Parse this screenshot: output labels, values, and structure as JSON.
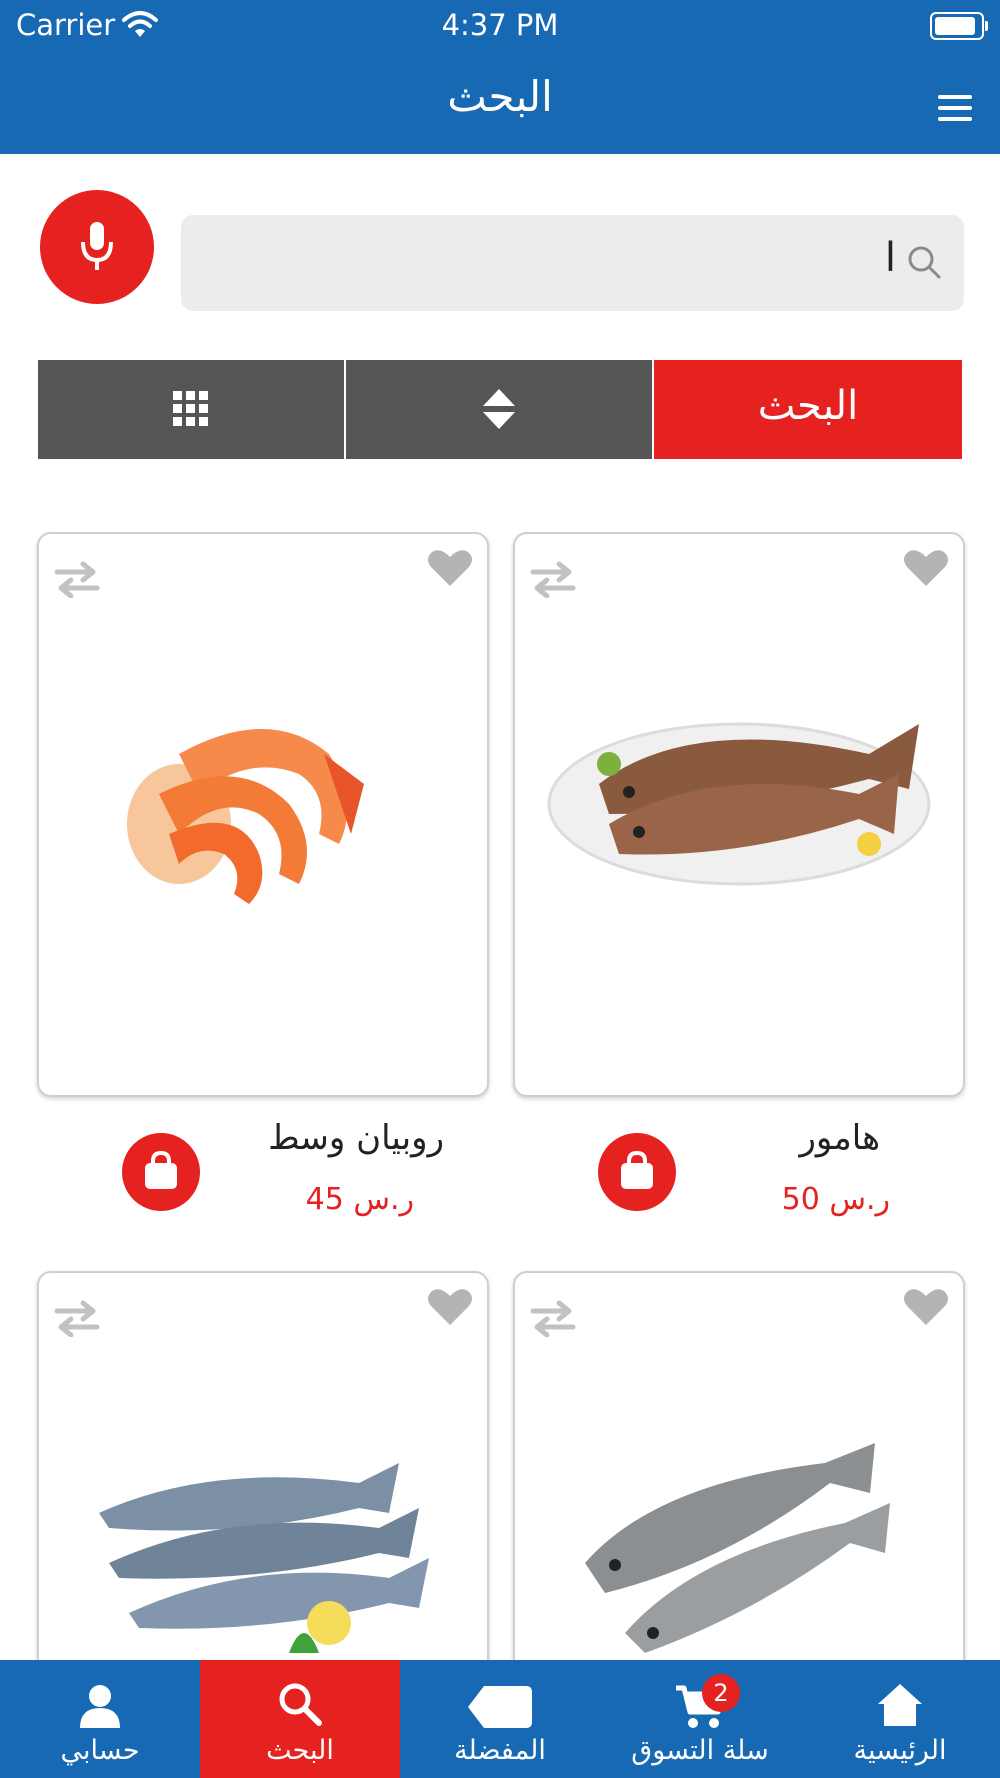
{
  "status_bar": {
    "carrier": "Carrier",
    "time": "4:37 PM"
  },
  "header": {
    "title": "البحث",
    "menu_icon": "hamburger-menu-icon"
  },
  "search": {
    "value": "ا",
    "icon": "search-icon",
    "mic_icon": "microphone-icon"
  },
  "toolbar": {
    "search_label": "البحث",
    "sort_icon": "sort-icon",
    "grid_icon": "grid-view-icon"
  },
  "products": [
    {
      "name": "روبيان وسط",
      "price": "ر.س 45",
      "image": "shrimp"
    },
    {
      "name": "هامور",
      "price": "ر.س 50",
      "image": "grouper-fish"
    },
    {
      "name": "",
      "price": "",
      "image": "mackerel-fish"
    },
    {
      "name": "",
      "price": "",
      "image": "trout-fish"
    }
  ],
  "tabbar": {
    "items": [
      {
        "label": "حسابي",
        "icon": "account-icon",
        "active": false
      },
      {
        "label": "البحث",
        "icon": "search-icon",
        "active": true
      },
      {
        "label": "المفضلة",
        "icon": "tag-icon",
        "active": false
      },
      {
        "label": "سلة التسوق",
        "icon": "cart-icon",
        "active": false,
        "badge": "2"
      },
      {
        "label": "الرئيسية",
        "icon": "home-icon",
        "active": false
      }
    ]
  },
  "colors": {
    "primary": "#1769b3",
    "accent": "#e52220",
    "toolbar_gray": "#555555"
  }
}
